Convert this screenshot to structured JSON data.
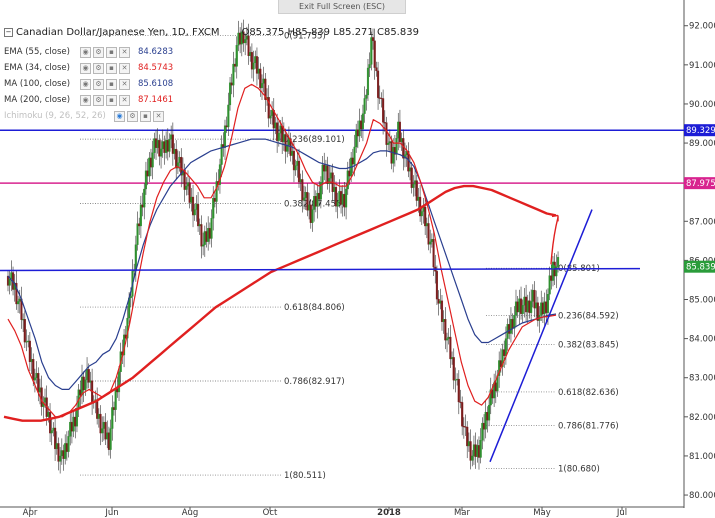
{
  "toolbar": {
    "exit_fullscreen": "Exit Full Screen (ESC)"
  },
  "header": {
    "symbol": "Canadian Dollar/Japanese Yen, 1D, FXCM",
    "open": "O85.375",
    "high": "H85.839",
    "low": "L85.271",
    "close": "C85.839"
  },
  "indicators": [
    {
      "name": "EMA (55, close)",
      "value": "84.6283",
      "color": "#2a3f8f"
    },
    {
      "name": "EMA (34, close)",
      "value": "84.5743",
      "color": "#e02020"
    },
    {
      "name": "MA (100, close)",
      "value": "85.6108",
      "color": "#2a3f8f"
    },
    {
      "name": "MA (200, close)",
      "value": "87.1461",
      "color": "#e02020"
    },
    {
      "name": "Ichimoku (9, 26, 52, 26)",
      "value": "",
      "color": "#c0c0c0"
    }
  ],
  "chart_data": {
    "type": "candlestick",
    "y_axis": {
      "ylim": [
        79.95,
        92.3
      ],
      "ticks": [
        "92.000",
        "91.000",
        "90.000",
        "89.000",
        "88.000",
        "87.000",
        "86.000",
        "85.000",
        "84.000",
        "83.000",
        "82.000",
        "81.000",
        "80.000"
      ],
      "price_labels": [
        {
          "value": 89.329,
          "text": "89.329",
          "color": "#1d1dd6"
        },
        {
          "value": 87.975,
          "text": "87.975",
          "color": "#d8248f"
        },
        {
          "value": 85.839,
          "text": "85.839",
          "color": "#2a9c3a"
        }
      ]
    },
    "x_axis": {
      "ticks": [
        "Apr",
        "Jun",
        "Aug",
        "Oct",
        "2018",
        "Mar",
        "May",
        "Jul"
      ],
      "tick_bold": [
        false,
        false,
        false,
        false,
        true,
        false,
        false,
        false
      ]
    },
    "fib_left": [
      {
        "text": "0(91.755)",
        "value": 91.755
      },
      {
        "text": "0.236(89.101)",
        "value": 89.101
      },
      {
        "text": "0.382(87.455)",
        "value": 87.455
      },
      {
        "text": "0.618(84.806)",
        "value": 84.806
      },
      {
        "text": "0.786(82.917)",
        "value": 82.917
      },
      {
        "text": "1(80.511)",
        "value": 80.511
      }
    ],
    "fib_right": [
      {
        "text": "0(85.801)",
        "value": 85.801
      },
      {
        "text": "0.236(84.592)",
        "value": 84.592
      },
      {
        "text": "0.382(83.845)",
        "value": 83.845
      },
      {
        "text": "0.618(82.636)",
        "value": 82.636
      },
      {
        "text": "0.786(81.776)",
        "value": 81.776
      },
      {
        "text": "1(80.680)",
        "value": 80.68
      }
    ],
    "horizontal_lines": [
      {
        "value": 89.329,
        "color": "#1d1dd6"
      },
      {
        "value": 87.975,
        "color": "#d8248f"
      }
    ],
    "series_price": [
      85.6,
      85.3,
      84.6,
      83.7,
      83.0,
      82.5,
      82.0,
      81.3,
      80.9,
      81.5,
      82.0,
      82.9,
      83.0,
      82.2,
      81.7,
      81.4,
      82.6,
      83.7,
      84.8,
      86.4,
      87.6,
      88.5,
      89.0,
      88.8,
      89.1,
      88.6,
      88.2,
      87.6,
      87.2,
      86.4,
      86.8,
      87.9,
      89.0,
      90.3,
      91.5,
      91.8,
      91.2,
      90.9,
      90.4,
      89.7,
      89.3,
      89.1,
      88.8,
      88.3,
      87.6,
      87.2,
      87.6,
      88.4,
      88.0,
      87.5,
      87.6,
      88.5,
      89.3,
      89.9,
      91.7,
      90.4,
      89.4,
      88.6,
      89.3,
      88.7,
      88.1,
      87.5,
      87.0,
      86.3,
      84.9,
      84.2,
      83.4,
      82.5,
      81.5,
      81.0,
      81.2,
      82.0,
      82.6,
      83.2,
      84.0,
      84.5,
      84.9,
      84.8,
      85.0,
      84.6,
      84.9,
      85.84
    ],
    "ma_blue": [
      85.6,
      85.4,
      85.0,
      84.5,
      84.0,
      83.4,
      83.0,
      82.8,
      82.7,
      82.7,
      82.9,
      83.1,
      83.3,
      83.4,
      83.6,
      83.7,
      84.0,
      84.5,
      85.1,
      85.8,
      86.4,
      86.9,
      87.3,
      87.6,
      87.9,
      88.1,
      88.3,
      88.5,
      88.6,
      88.7,
      88.8,
      88.85,
      88.9,
      88.95,
      89.0,
      89.05,
      89.1,
      89.1,
      89.1,
      89.05,
      89.0,
      88.95,
      88.9,
      88.8,
      88.7,
      88.6,
      88.5,
      88.45,
      88.4,
      88.35,
      88.35,
      88.4,
      88.5,
      88.6,
      88.75,
      88.8,
      88.8,
      88.75,
      88.7,
      88.6,
      88.4,
      88.0,
      87.5,
      87.0,
      86.5,
      86.0,
      85.5,
      85.0,
      84.5,
      84.1,
      83.9,
      83.9,
      84.0,
      84.1,
      84.2,
      84.3,
      84.4,
      84.45,
      84.5,
      84.55,
      84.6,
      84.63
    ],
    "ema_red": [
      84.5,
      84.2,
      83.8,
      83.2,
      82.8,
      82.4,
      82.2,
      82.0,
      82.0,
      82.1,
      82.3,
      82.6,
      82.7,
      82.6,
      82.5,
      82.6,
      83.0,
      83.6,
      84.4,
      85.3,
      86.2,
      87.0,
      87.6,
      88.0,
      88.3,
      88.4,
      88.3,
      88.1,
      87.9,
      87.6,
      87.6,
      87.9,
      88.4,
      89.1,
      89.9,
      90.4,
      90.5,
      90.4,
      90.2,
      89.9,
      89.6,
      89.3,
      89.0,
      88.7,
      88.3,
      88.0,
      87.9,
      88.0,
      88.0,
      87.9,
      87.9,
      88.2,
      88.6,
      89.0,
      89.6,
      89.5,
      89.3,
      89.0,
      89.0,
      88.8,
      88.5,
      88.0,
      87.4,
      86.7,
      85.8,
      85.0,
      84.2,
      83.4,
      82.8,
      82.4,
      82.3,
      82.5,
      82.9,
      83.3,
      83.7,
      84.0,
      84.3,
      84.4,
      84.5,
      84.55,
      84.57,
      84.6
    ],
    "ma200_red": [
      82.0,
      81.95,
      81.9,
      81.9,
      81.9,
      81.95,
      82.0,
      82.1,
      82.2,
      82.3,
      82.4,
      82.55,
      82.7,
      82.85,
      83.0,
      83.2,
      83.4,
      83.6,
      83.8,
      84.0,
      84.2,
      84.4,
      84.6,
      84.8,
      84.95,
      85.1,
      85.25,
      85.4,
      85.55,
      85.7,
      85.8,
      85.9,
      86.0,
      86.1,
      86.2,
      86.3,
      86.4,
      86.5,
      86.6,
      86.7,
      86.8,
      86.9,
      87.0,
      87.1,
      87.2,
      87.3,
      87.45,
      87.6,
      87.75,
      87.85,
      87.9,
      87.9,
      87.85,
      87.8,
      87.7,
      87.6,
      87.5,
      87.4,
      87.3,
      87.2,
      87.15
    ],
    "trendline_horizontal": 85.84,
    "trendline_rising": [
      80.85,
      87.3
    ],
    "projected_arrow_to": 87.0
  }
}
